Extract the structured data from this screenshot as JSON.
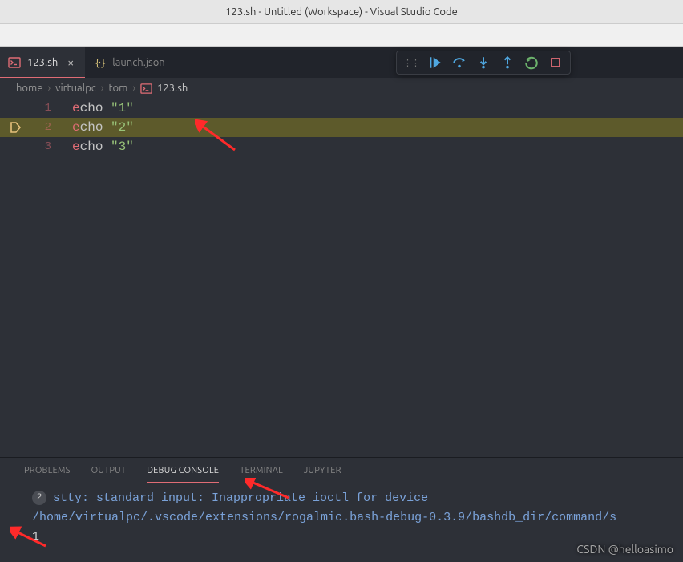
{
  "window": {
    "title": "123.sh - Untitled (Workspace) - Visual Studio Code"
  },
  "tabs": [
    {
      "label": "123.sh",
      "active": true,
      "icon": "shell"
    },
    {
      "label": "launch.json",
      "active": false,
      "icon": "json"
    }
  ],
  "breadcrumbs": {
    "parts": [
      "home",
      "virtualpc",
      "tom"
    ],
    "file": "123.sh"
  },
  "editor": {
    "lines": [
      {
        "num": "1",
        "cmd": "echo",
        "str": "\"1\""
      },
      {
        "num": "2",
        "cmd": "echo",
        "str": "\"2\""
      },
      {
        "num": "3",
        "cmd": "echo",
        "str": "\"3\""
      }
    ],
    "current_line_index": 1
  },
  "panel": {
    "tabs": [
      "PROBLEMS",
      "OUTPUT",
      "DEBUG CONSOLE",
      "TERMINAL",
      "JUPYTER"
    ],
    "active_tab_index": 2,
    "console": {
      "badge1": "2",
      "line1": "stty: standard input: Inappropriate ioctl for device",
      "line2": "/home/virtualpc/.vscode/extensions/rogalmic.bash-debug-0.3.9/bashdb_dir/command/s",
      "out_val": "1"
    }
  },
  "watermark": "CSDN @helloasimo"
}
